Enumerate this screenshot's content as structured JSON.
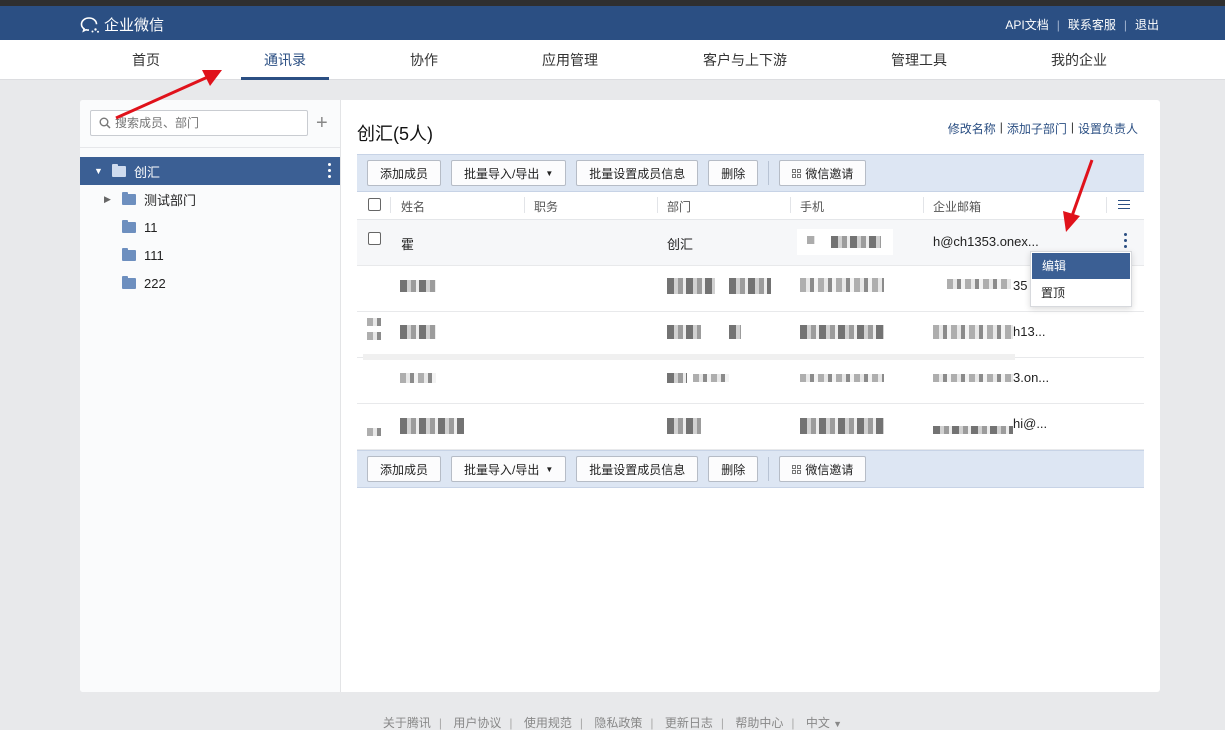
{
  "topbar": {
    "brand": "企业微信",
    "links": [
      "API文档",
      "联系客服",
      "退出"
    ]
  },
  "nav": {
    "tabs": [
      "首页",
      "通讯录",
      "协作",
      "应用管理",
      "客户与上下游",
      "管理工具",
      "我的企业"
    ],
    "active": "通讯录"
  },
  "sidebar": {
    "search_placeholder": "搜索成员、部门",
    "root": "创汇",
    "departments": [
      "测试部门",
      "11",
      "111",
      "222"
    ]
  },
  "main": {
    "title": "创汇(5人)",
    "actions": [
      "修改名称",
      "添加子部门",
      "设置负责人"
    ],
    "toolbar": {
      "add_member": "添加成员",
      "bulk_import_export": "批量导入/导出",
      "bulk_set_info": "批量设置成员信息",
      "delete": "删除",
      "wechat_invite": "微信邀请"
    },
    "columns": [
      "姓名",
      "职务",
      "部门",
      "手机",
      "企业邮箱"
    ],
    "rows": [
      {
        "name": "霍",
        "department": "创汇",
        "email": "h@ch1353.onex..."
      },
      {
        "email_fragment": "35"
      },
      {
        "email_fragment": "h13..."
      },
      {
        "email_fragment": "3.on..."
      },
      {
        "email_fragment": "hi@..."
      }
    ]
  },
  "row_menu": [
    "编辑",
    "置顶"
  ],
  "footer": [
    "关于腾讯",
    "用户协议",
    "使用规范",
    "隐私政策",
    "更新日志",
    "帮助中心",
    "中文"
  ],
  "colors": {
    "brand": "#2b4f83",
    "annotation_arrow": "#e0121b"
  }
}
